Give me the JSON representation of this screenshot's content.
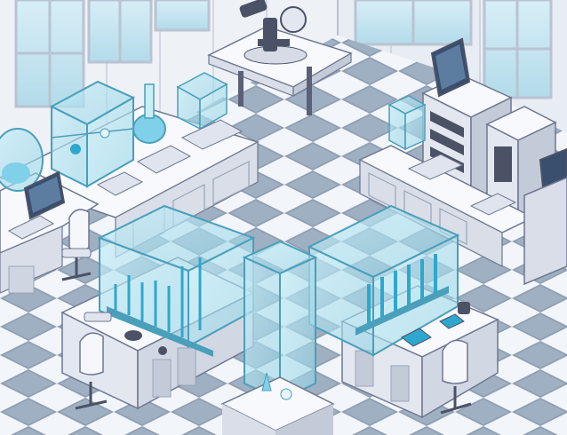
{
  "scene": {
    "palette": {
      "wall": "#eef1f6",
      "wall_panel": "#dfe4ee",
      "window_frame": "#cfd6e3",
      "window_glass": "#bfe3f0",
      "floor_light": "#f2f5f9",
      "floor_dark": "#8f9fb1",
      "counter_top": "#f7f9fc",
      "cabinet": "#d9dee8",
      "cabinet_dark": "#9aa5b8",
      "glass_case": "#9ed9e8",
      "glass_edge": "#4a9fba",
      "liquid": "#2ea7cf",
      "outline": "#4b5266",
      "accent_purple": "#6f6a8e",
      "screen": "#3a4e6e",
      "screen_glow": "#7fd0e8"
    },
    "objects": [
      {
        "id": "microscope",
        "icon": "microscope-icon"
      },
      {
        "id": "left-glass-cabinet",
        "icon": "glass-cabinet-icon"
      },
      {
        "id": "right-glass-cabinet",
        "icon": "glass-cabinet-icon"
      },
      {
        "id": "center-glass-enclosure",
        "icon": "glass-enclosure-icon"
      },
      {
        "id": "server-rack",
        "icon": "server-rack-icon"
      },
      {
        "id": "desktop-computer",
        "icon": "computer-icon"
      }
    ]
  }
}
